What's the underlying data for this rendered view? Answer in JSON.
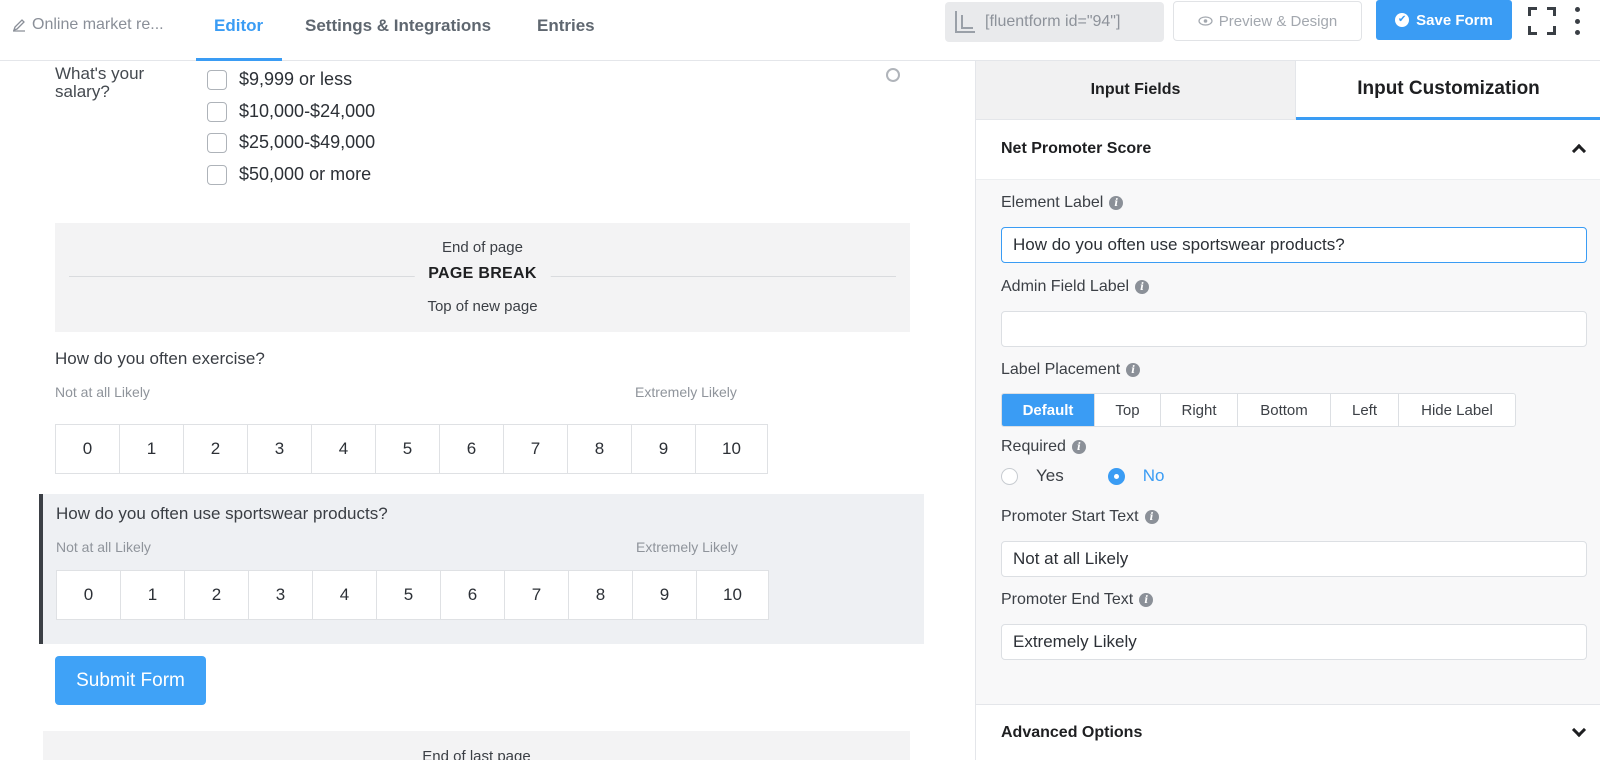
{
  "header": {
    "breadcrumb": "Online market re...",
    "tabs": [
      {
        "label": "Editor"
      },
      {
        "label": "Settings & Integrations"
      },
      {
        "label": "Entries"
      }
    ],
    "shortcode": "[fluentform id=\"94\"]",
    "preview_label": "Preview & Design",
    "save_label": "Save Form"
  },
  "editor": {
    "salary": {
      "label": "What's your salary?",
      "options": [
        "$9,999 or less",
        "$10,000-$24,000",
        "$25,000-$49,000",
        "$50,000 or more"
      ]
    },
    "page_break": {
      "top": "End of page",
      "title": "PAGE BREAK",
      "bottom": "Top of new page"
    },
    "nps": [
      {
        "question": "How do you often exercise?",
        "start_text": "Not at all Likely",
        "end_text": "Extremely Likely",
        "scale": [
          "0",
          "1",
          "2",
          "3",
          "4",
          "5",
          "6",
          "7",
          "8",
          "9",
          "10"
        ]
      },
      {
        "question": "How do you often use sportswear products?",
        "start_text": "Not at all Likely",
        "end_text": "Extremely Likely",
        "scale": [
          "0",
          "1",
          "2",
          "3",
          "4",
          "5",
          "6",
          "7",
          "8",
          "9",
          "10"
        ]
      }
    ],
    "submit_label": "Submit Form",
    "last_page": "End of last page"
  },
  "panel": {
    "tabs": [
      {
        "label": "Input Fields"
      },
      {
        "label": "Input Customization"
      }
    ],
    "section_title": "Net Promoter Score",
    "element_label": {
      "label": "Element Label",
      "value": "How do you often use sportswear products?"
    },
    "admin_label": {
      "label": "Admin Field Label",
      "value": ""
    },
    "label_placement": {
      "label": "Label Placement",
      "options": [
        "Default",
        "Top",
        "Right",
        "Bottom",
        "Left",
        "Hide Label"
      ],
      "selected": "Default"
    },
    "required": {
      "label": "Required",
      "yes": "Yes",
      "no": "No",
      "selected": "No"
    },
    "promoter_start": {
      "label": "Promoter Start Text",
      "value": "Not at all Likely"
    },
    "promoter_end": {
      "label": "Promoter End Text",
      "value": "Extremely Likely"
    },
    "advanced_title": "Advanced Options"
  },
  "colors": {
    "accent": "#3a9cf4",
    "selected_block_bg": "#eef0f3"
  }
}
